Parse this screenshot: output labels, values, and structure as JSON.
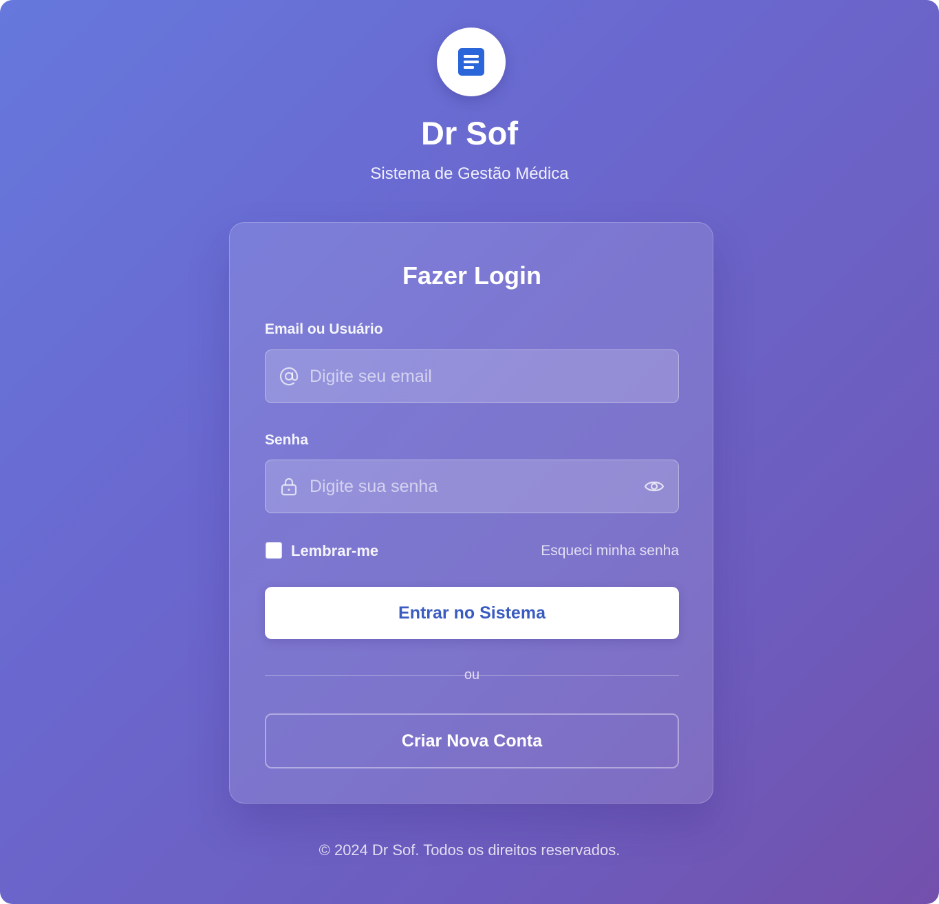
{
  "brand": {
    "logo_icon": "document-icon",
    "logo_color": "#2a66d9",
    "title": "Dr Sof",
    "subtitle": "Sistema de Gestão Médica"
  },
  "login": {
    "title": "Fazer Login",
    "email": {
      "label": "Email ou Usuário",
      "placeholder": "Digite seu email",
      "value": "",
      "icon": "at-sign-icon"
    },
    "password": {
      "label": "Senha",
      "placeholder": "Digite sua senha",
      "value": "",
      "icon": "lock-icon",
      "toggle_icon": "eye-icon"
    },
    "remember_label": "Lembrar-me",
    "remember_checked": false,
    "forgot_label": "Esqueci minha senha",
    "submit_label": "Entrar no Sistema",
    "divider_text": "ou",
    "create_account_label": "Criar Nova Conta"
  },
  "footer": {
    "text": "© 2024 Dr Sof. Todos os direitos reservados."
  },
  "colors": {
    "background_start": "#6678dc",
    "background_end": "#7350ac",
    "primary_button_text": "#3a5bc0"
  }
}
